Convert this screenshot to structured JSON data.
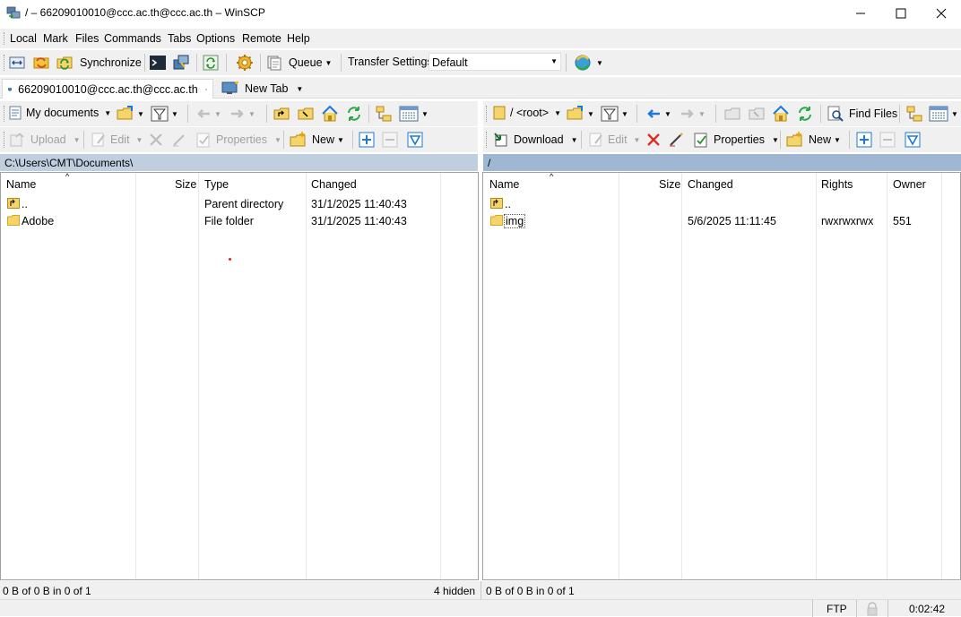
{
  "window": {
    "title": "/ – 66209010010@ccc.ac.th@ccc.ac.th – WinSCP"
  },
  "menu": [
    "Local",
    "Mark",
    "Files",
    "Commands",
    "Tabs",
    "Options",
    "Remote",
    "Help"
  ],
  "toolbar": {
    "synchronize_label": "Synchronize",
    "queue_label": "Queue",
    "transfer_settings_label": "Transfer Settings",
    "transfer_preset_value": "Default"
  },
  "tabs": {
    "session_label": "66209010010@ccc.ac.th@ccc.ac.th",
    "new_tab_label": "New Tab"
  },
  "local": {
    "location_label": "My documents",
    "actions": {
      "upload": "Upload",
      "edit": "Edit",
      "properties": "Properties",
      "new": "New"
    },
    "path": "C:\\Users\\CMT\\Documents\\",
    "columns": [
      "Name",
      "Size",
      "Type",
      "Changed"
    ],
    "rows": [
      {
        "name": "..",
        "size": "",
        "type": "Parent directory",
        "changed": "31/1/2025 11:40:43"
      },
      {
        "name": "Adobe",
        "size": "",
        "type": "File folder",
        "changed": "31/1/2025 11:40:43"
      }
    ],
    "status_left": "0 B of 0 B in 0 of 1",
    "status_hidden": "4 hidden"
  },
  "remote": {
    "location_label": "/ <root>",
    "find_files_label": "Find Files",
    "actions": {
      "download": "Download",
      "edit": "Edit",
      "properties": "Properties",
      "new": "New"
    },
    "path": "/",
    "columns": [
      "Name",
      "Size",
      "Changed",
      "Rights",
      "Owner"
    ],
    "rows": [
      {
        "name": "..",
        "size": "",
        "changed": "",
        "rights": "",
        "owner": ""
      },
      {
        "name": "img",
        "size": "",
        "changed": "5/6/2025 11:11:45",
        "rights": "rwxrwxrwx",
        "owner": "551"
      }
    ],
    "status_left": "0 B of 0 B in 0 of 1"
  },
  "statusbar": {
    "protocol": "FTP",
    "elapsed": "0:02:42"
  },
  "colors": {
    "local_path_bg": "#bfcfdf",
    "remote_path_bg": "#9fb7d3",
    "folder_yellow": "#f5d46b",
    "accent_blue": "#1c7ad6"
  }
}
